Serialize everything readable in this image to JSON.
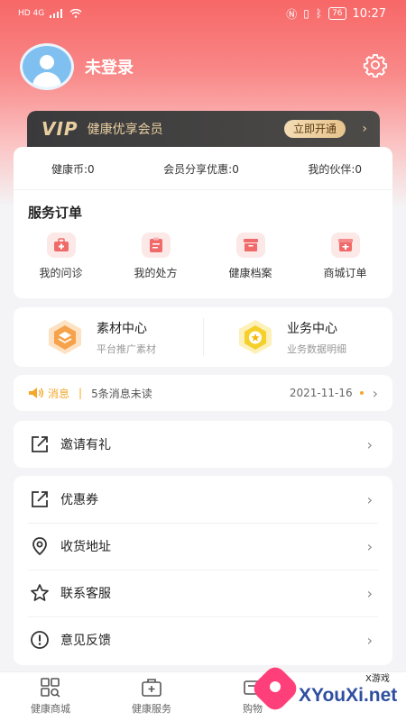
{
  "status_bar": {
    "left": "HD 4G",
    "battery": "76",
    "time": "10:27"
  },
  "profile": {
    "username": "未登录"
  },
  "vip": {
    "logo": "VIP",
    "text": "健康优享会员",
    "button": "立即开通",
    "arrow": "›"
  },
  "stats": {
    "coins": "健康币:0",
    "share": "会员分享优惠:0",
    "partners": "我的伙伴:0"
  },
  "orders": {
    "title": "服务订单",
    "items": [
      {
        "label": "我的问诊"
      },
      {
        "label": "我的处方"
      },
      {
        "label": "健康档案"
      },
      {
        "label": "商城订单"
      }
    ]
  },
  "centers": {
    "material": {
      "title": "素材中心",
      "sub": "平台推广素材"
    },
    "business": {
      "title": "业务中心",
      "sub": "业务数据明细"
    }
  },
  "message": {
    "label": "消息",
    "sep": "|",
    "text": "5条消息未读",
    "date": "2021-11-16",
    "chevron": "›"
  },
  "menu": {
    "invite": "邀请有礼",
    "items": [
      {
        "label": "优惠券"
      },
      {
        "label": "收货地址"
      },
      {
        "label": "联系客服"
      },
      {
        "label": "意见反馈"
      }
    ],
    "chevron": "›"
  },
  "tabbar": {
    "items": [
      {
        "label": "健康商城"
      },
      {
        "label": "健康服务"
      },
      {
        "label": "购物"
      }
    ]
  },
  "watermark": {
    "small": "X游戏",
    "big": "XYouXi.net"
  },
  "colors": {
    "header_red": "#f76767",
    "gold": "#e9cfa0",
    "accent_orange": "#f4a72b"
  }
}
